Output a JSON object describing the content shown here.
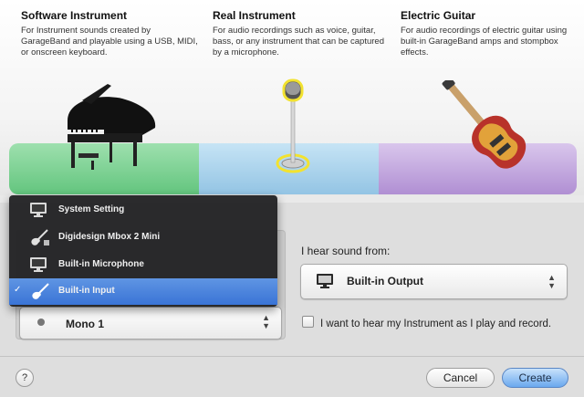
{
  "instruments": [
    {
      "title": "Software Instrument",
      "description": "For Instrument sounds created by GarageBand and playable using a USB, MIDI, or onscreen keyboard.",
      "icon": "grand-piano"
    },
    {
      "title": "Real Instrument",
      "description": "For audio recordings such as voice, guitar, bass, or any instrument that can be captured by a microphone.",
      "icon": "microphone-stand"
    },
    {
      "title": "Electric Guitar",
      "description": "For audio recordings of electric guitar using built-in GarageBand amps and stompbox effects.",
      "icon": "electric-guitar"
    }
  ],
  "input_menu": {
    "items": [
      {
        "label": "System Setting",
        "icon": "monitor-icon",
        "selected": false
      },
      {
        "label": "Digidesign Mbox 2 Mini",
        "icon": "guitar-usb-icon",
        "selected": false
      },
      {
        "label": "Built-in Microphone",
        "icon": "monitor-icon",
        "selected": false
      },
      {
        "label": "Built-in Input",
        "icon": "guitar-icon",
        "selected": true
      }
    ],
    "check_glyph": "✓"
  },
  "channel_popup": {
    "value": "Mono 1"
  },
  "output": {
    "label": "I hear sound from:",
    "value": "Built-in Output"
  },
  "monitor_checkbox": {
    "label": "I want to hear my Instrument as I play and record.",
    "checked": false
  },
  "footer": {
    "help": "?",
    "cancel": "Cancel",
    "create": "Create"
  },
  "colors": {
    "selected": "#3a74d6",
    "software_band": "#63c57e",
    "real_band": "#93c4e4",
    "guitar_band": "#b08fd3"
  }
}
